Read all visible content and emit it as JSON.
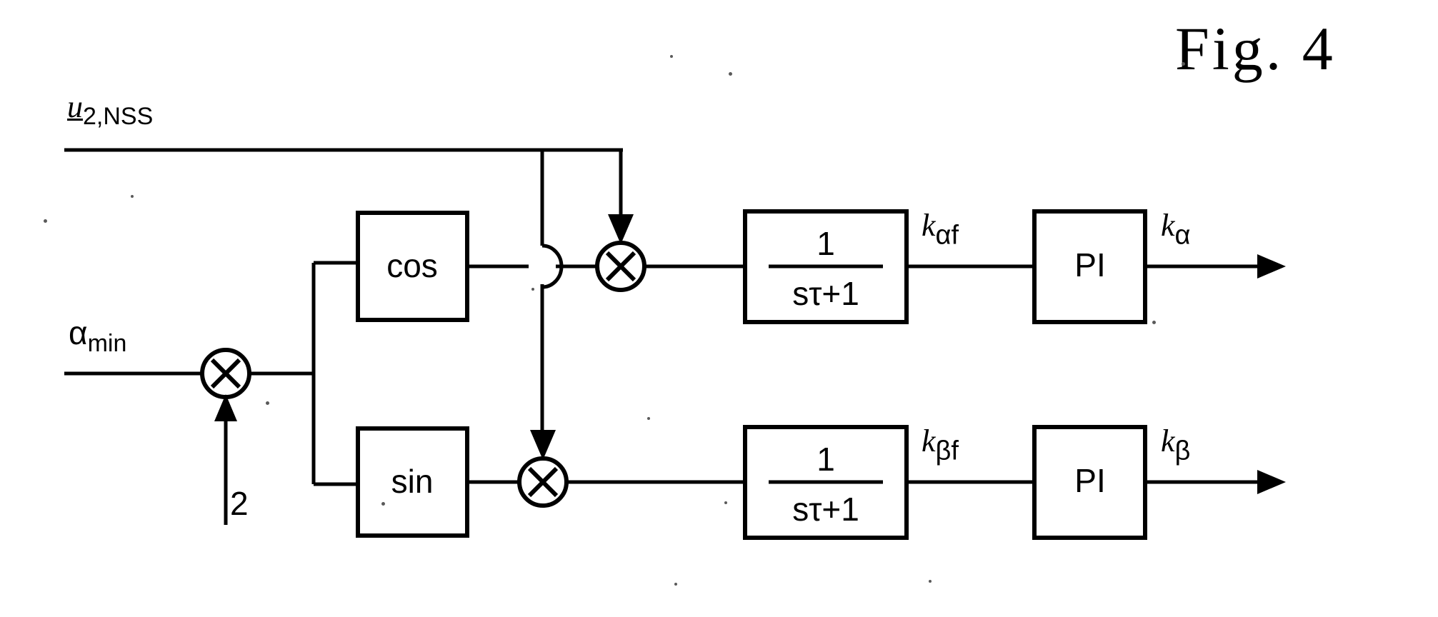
{
  "figure": {
    "title": "Fig. 4",
    "type": "control-block-diagram",
    "description": "Block diagram computing alpha/beta filter gains from a doubled minimum firing angle via cosine and sine modulation of the u2,NSS signal, first-order lag filters and PI controllers."
  },
  "inputs": {
    "top_signal": {
      "base": "u",
      "subscript": "2,NSS",
      "underlined": true
    },
    "angle_signal": {
      "base": "α",
      "subscript": "min"
    },
    "gain_constant": "2"
  },
  "blocks": {
    "cos_block": {
      "label": "cos"
    },
    "sin_block": {
      "label": "sin"
    },
    "lag_upper": {
      "numerator": "1",
      "denominator": "sτ+1"
    },
    "lag_lower": {
      "numerator": "1",
      "denominator": "sτ+1"
    },
    "pi_upper": {
      "label": "PI"
    },
    "pi_lower": {
      "label": "PI"
    }
  },
  "operators": {
    "mult_angle": {
      "symbol": "×",
      "name": "multiplier"
    },
    "mult_cos": {
      "symbol": "×",
      "name": "multiplier"
    },
    "mult_sin": {
      "symbol": "×",
      "name": "multiplier"
    }
  },
  "signals": {
    "k_alpha_f": {
      "base": "k",
      "subscript": "αf"
    },
    "k_beta_f": {
      "base": "k",
      "subscript": "βf"
    },
    "k_alpha_out": {
      "base": "k",
      "subscript": "α"
    },
    "k_beta_out": {
      "base": "k",
      "subscript": "β"
    }
  },
  "colors": {
    "line": "#000000",
    "background": "#ffffff",
    "text": "#000000"
  }
}
